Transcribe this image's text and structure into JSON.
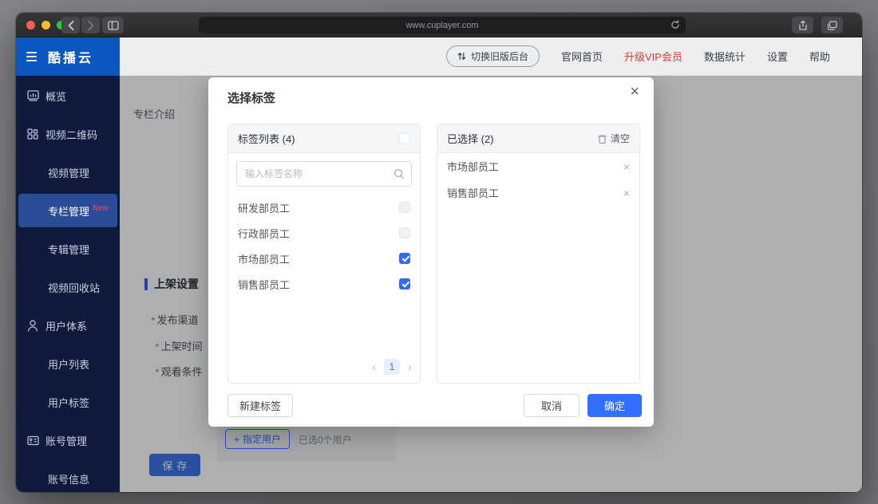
{
  "browser": {
    "url": "www.cuplayer.com"
  },
  "header": {
    "logo": "酷播云",
    "switch_old_version": "切换旧版后台",
    "links": [
      {
        "label": "官网首页",
        "highlight": false
      },
      {
        "label": "升级VIP会员",
        "highlight": true
      },
      {
        "label": "数据统计",
        "highlight": false
      },
      {
        "label": "设置",
        "highlight": false
      },
      {
        "label": "帮助",
        "highlight": false
      }
    ]
  },
  "sidebar": {
    "items": [
      {
        "label": "概览",
        "icon": "overview-icon",
        "sub": false,
        "active": false
      },
      {
        "label": "视频二维码",
        "icon": "qrcode-icon",
        "sub": false,
        "active": false
      },
      {
        "label": "视频管理",
        "sub": true,
        "active": false
      },
      {
        "label": "专栏管理",
        "sub": true,
        "active": true,
        "badge": "New"
      },
      {
        "label": "专辑管理",
        "sub": true,
        "active": false
      },
      {
        "label": "视频回收站",
        "sub": true,
        "active": false
      },
      {
        "label": "用户体系",
        "icon": "user-icon",
        "sub": false,
        "active": false
      },
      {
        "label": "用户列表",
        "sub": true,
        "active": false
      },
      {
        "label": "用户标签",
        "sub": true,
        "active": false
      },
      {
        "label": "账号管理",
        "icon": "idcard-icon",
        "sub": false,
        "active": false
      },
      {
        "label": "账号信息",
        "sub": true,
        "active": false
      }
    ]
  },
  "content": {
    "intro_label": "专栏介绍",
    "section_title": "上架设置",
    "required_mark": "*",
    "fields": [
      {
        "label": "发布渠道"
      },
      {
        "label": "上架时间"
      },
      {
        "label": "观看条件"
      }
    ],
    "assign_user": {
      "plus": "+",
      "label": "指定用户",
      "hint": "已选0个用户"
    },
    "save_label": "保存"
  },
  "modal": {
    "title": "选择标签",
    "close_glyph": "×",
    "left_panel": {
      "header": "标签列表 (4)",
      "search_placeholder": "输入标签名称",
      "tags": [
        {
          "name": "研发部员工",
          "checked": false
        },
        {
          "name": "行政部员工",
          "checked": false
        },
        {
          "name": "市场部员工",
          "checked": true
        },
        {
          "name": "销售部员工",
          "checked": true
        }
      ],
      "pagination": {
        "prev": "‹",
        "current": "1",
        "next": "›"
      }
    },
    "right_panel": {
      "header": "已选择 (2)",
      "clear_label": "清空",
      "remove_glyph": "×",
      "selected": [
        "市场部员工",
        "销售部员工"
      ]
    },
    "footer": {
      "new_tag": "新建标签",
      "cancel": "取消",
      "confirm": "确定"
    }
  },
  "theme": {
    "accent_blue": "#3370ff",
    "logo_blue": "#0c56c0",
    "sidebar_navy": "#0e1b3c",
    "active_item_blue": "#2a4e96",
    "danger_red": "#de3b38",
    "badge_red": "#f5455c",
    "checked_blue": "#3168f5"
  }
}
